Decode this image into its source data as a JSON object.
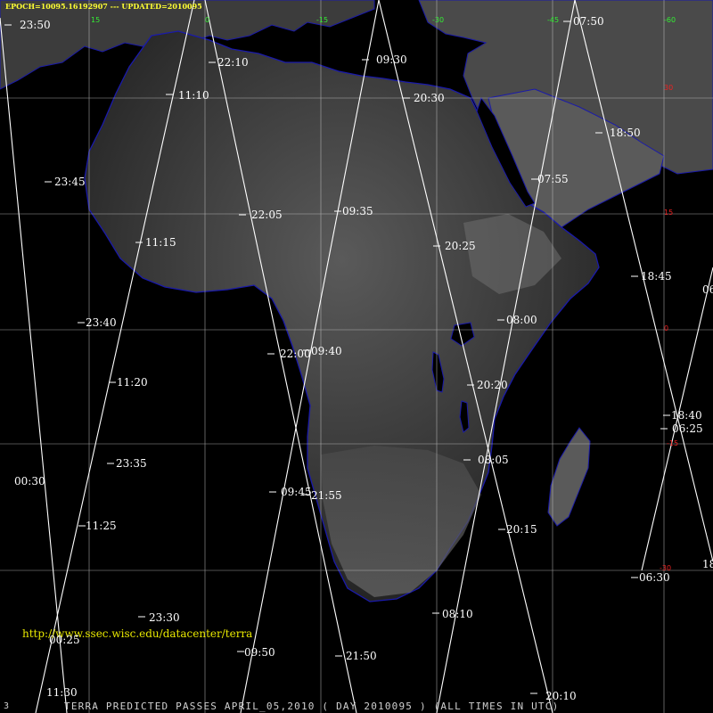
{
  "header": {
    "epoch_line": "EPOCH=10095.16192907 --- UPDATED=2010095"
  },
  "footer": {
    "page_number": "3",
    "title": "TERRA PREDICTED PASSES APRIL_05,2010 ( DAY 2010095 ) (ALL TIMES IN UTC)",
    "url": "http://www.ssec.wisc.edu/datacenter/terra"
  },
  "longitude_labels": [
    "15",
    "0",
    "-15",
    "-30",
    "-45",
    "-60"
  ],
  "latitude_labels": [
    "30",
    "15",
    "0",
    "-15",
    "-30"
  ],
  "colors": {
    "background": "#000000",
    "land_dark": "#2a2a2a",
    "land_light": "#6e6e6e",
    "coastline": "#1a1aaa",
    "grid": "#c8c8c8",
    "orbit_track": "#ffffff",
    "header_text": "#ffff33",
    "longitude_text": "#33ee33",
    "latitude_text": "#ee2222"
  },
  "passes": [
    {
      "time": "23:50"
    },
    {
      "time": "23:45"
    },
    {
      "time": "23:40"
    },
    {
      "time": "23:35"
    },
    {
      "time": "23:30"
    },
    {
      "time": "00:25"
    },
    {
      "time": "00:30"
    },
    {
      "time": "22:10"
    },
    {
      "time": "22:05"
    },
    {
      "time": "22:00"
    },
    {
      "time": "21:55"
    },
    {
      "time": "21:50"
    },
    {
      "time": "11:10"
    },
    {
      "time": "11:15"
    },
    {
      "time": "11:20"
    },
    {
      "time": "11:25"
    },
    {
      "time": "11:30"
    },
    {
      "time": "09:30"
    },
    {
      "time": "09:35"
    },
    {
      "time": "09:40"
    },
    {
      "time": "09:45"
    },
    {
      "time": "09:50"
    },
    {
      "time": "20:30"
    },
    {
      "time": "20:25"
    },
    {
      "time": "20:20"
    },
    {
      "time": "20:15"
    },
    {
      "time": "20:10"
    },
    {
      "time": "07:50"
    },
    {
      "time": "07:55"
    },
    {
      "time": "08:00"
    },
    {
      "time": "08:05"
    },
    {
      "time": "08:10"
    },
    {
      "time": "18:50"
    },
    {
      "time": "18:45"
    },
    {
      "time": "18:40"
    },
    {
      "time": "06:25"
    },
    {
      "time": "06:30"
    },
    {
      "time": "06"
    },
    {
      "time": "18"
    }
  ]
}
